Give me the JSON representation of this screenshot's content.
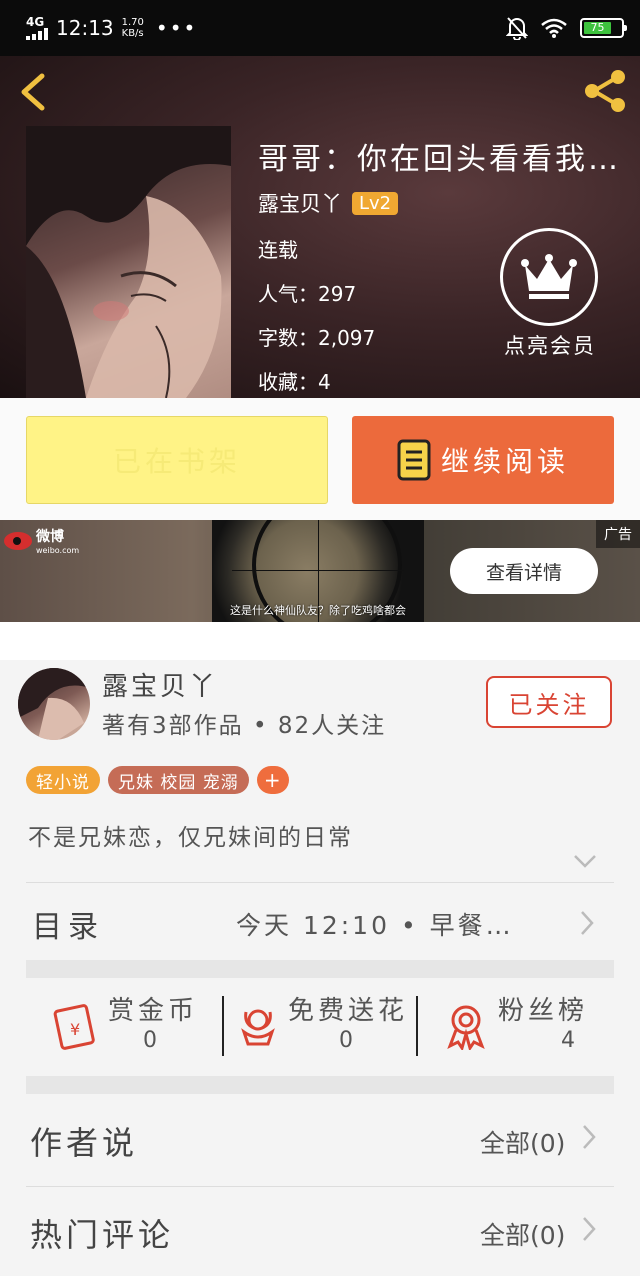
{
  "status_bar": {
    "network": "4G",
    "time": "12:13",
    "speed": "1.70",
    "speed_unit": "KB/s",
    "more": "•••",
    "battery": "75"
  },
  "book": {
    "title": "哥哥：你在回头看看我…",
    "author": "露宝贝丫",
    "level": "Lv2",
    "status": "连载",
    "popularity": "人气：297",
    "word_count": "字数：2,097",
    "favorites": "收藏：4"
  },
  "vip": {
    "label": "点亮会员"
  },
  "actions": {
    "on_shelf": "已在书架",
    "continue_reading": "继续阅读"
  },
  "ad": {
    "brand": "微博",
    "brand_sub": "weibo.com",
    "caption": "这是什么神仙队友？除了吃鸡啥都会",
    "detail_button": "查看详情",
    "tag": "广告"
  },
  "author": {
    "name": "露宝贝丫",
    "stats": "著有3部作品 • 82人关注",
    "follow_button": "已关注"
  },
  "tags": [
    {
      "label": "轻小说",
      "color": "#f2a335"
    },
    {
      "label": "兄妹 校园 宠溺",
      "color": "#c56c56"
    },
    {
      "label": "+",
      "color": "#ef6d3d"
    }
  ],
  "intro": "不是兄妹恋，仅兄妹间的日常",
  "toc": {
    "label": "目录",
    "latest": "今天  12:10  •  早餐…"
  },
  "stats": [
    {
      "name": "赏金币",
      "value": "0",
      "icon": "red-envelope-icon"
    },
    {
      "name": "免费送花",
      "value": "0",
      "icon": "flower-icon"
    },
    {
      "name": "粉丝榜",
      "value": "4",
      "icon": "medal-icon"
    }
  ],
  "author_says": {
    "label": "作者说",
    "all": "全部(0)"
  },
  "hot_comments": {
    "label": "热门评论",
    "all": "全部(0)"
  },
  "colors": {
    "accent_orange": "#ec6a3c",
    "shelf_yellow": "#fff386",
    "follow_red": "#d94433",
    "battery_green": "#3ec33e"
  }
}
